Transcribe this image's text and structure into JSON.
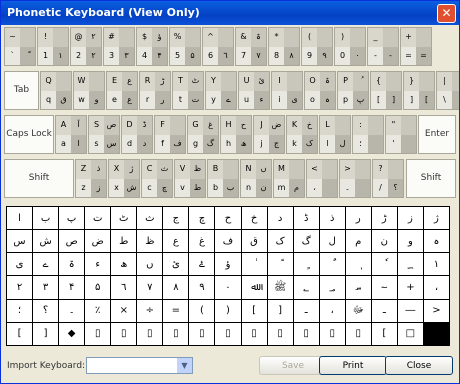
{
  "window": {
    "title": "Phonetic Keyboard (View Only)",
    "close": "✕"
  },
  "keys": {
    "row1": [
      [
        "~",
        "",
        "`",
        "ّ"
      ],
      [
        "!",
        "",
        "1",
        "١"
      ],
      [
        "@",
        "٢",
        "2",
        "٢"
      ],
      [
        "#",
        "",
        "3",
        "٣"
      ],
      [
        "$",
        "ؤ",
        "4",
        "۴"
      ],
      [
        "%",
        "",
        "5",
        "۵"
      ],
      [
        "^",
        "",
        "6",
        "٦"
      ],
      [
        "&",
        "ۃ",
        "7",
        "٧"
      ],
      [
        "*",
        "",
        "8",
        "٨"
      ],
      [
        "(",
        "",
        "9",
        "٩"
      ],
      [
        ")",
        "",
        "0",
        "٠"
      ],
      [
        "_",
        "",
        "-",
        "-"
      ],
      [
        "+",
        "",
        "=",
        "="
      ]
    ],
    "row2": [
      [
        "Q",
        "",
        "q",
        "ق"
      ],
      [
        "W",
        "",
        "w",
        "و"
      ],
      [
        "E",
        "ع",
        "e",
        "ع"
      ],
      [
        "R",
        "ڑ",
        "r",
        "ر"
      ],
      [
        "T",
        "ٹ",
        "t",
        "ت"
      ],
      [
        "Y",
        "",
        "y",
        "ے"
      ],
      [
        "U",
        "ئ",
        "u",
        "ء"
      ],
      [
        "I",
        "",
        "i",
        "ی"
      ],
      [
        "O",
        "ۃ",
        "o",
        "ہ"
      ],
      [
        "P",
        "ُ",
        "p",
        "پ"
      ],
      [
        "{",
        "",
        "[",
        "]"
      ],
      [
        "}",
        "",
        "]",
        "["
      ],
      [
        "|",
        "",
        "\\",
        ""
      ]
    ],
    "row3": [
      [
        "A",
        "آ",
        "a",
        "ا"
      ],
      [
        "S",
        "ص",
        "s",
        "س"
      ],
      [
        "D",
        "ڈ",
        "d",
        "د"
      ],
      [
        "F",
        "",
        "f",
        "ف"
      ],
      [
        "G",
        "غ",
        "g",
        "گ"
      ],
      [
        "H",
        "ح",
        "h",
        "ھ"
      ],
      [
        "J",
        "ض",
        "j",
        "ج"
      ],
      [
        "K",
        "خ",
        "k",
        "ک"
      ],
      [
        "L",
        "",
        "l",
        "ل"
      ],
      [
        ":",
        "",
        "؛",
        ""
      ],
      [
        "\"",
        "",
        "'",
        ""
      ]
    ],
    "row4": [
      [
        "Z",
        "ذ",
        "z",
        "ز"
      ],
      [
        "X",
        "ژ",
        "x",
        "ش"
      ],
      [
        "C",
        "ث",
        "c",
        "چ"
      ],
      [
        "V",
        "ظ",
        "v",
        "ط"
      ],
      [
        "B",
        "",
        "b",
        "ب"
      ],
      [
        "N",
        "ں",
        "n",
        "ن"
      ],
      [
        "M",
        "",
        "m",
        "م"
      ],
      [
        "<",
        "",
        "،",
        ""
      ],
      [
        ">",
        "",
        "۔",
        ""
      ],
      [
        "?",
        "",
        "/",
        "؟"
      ]
    ],
    "special": {
      "tab": "Tab",
      "caps": "Caps Lock",
      "enter": "Enter",
      "shift_left": "Shift",
      "shift_right": "Shift"
    }
  },
  "grid": [
    "ا",
    "ب",
    "پ",
    "ت",
    "ٹ",
    "ث",
    "ج",
    "چ",
    "ح",
    "خ",
    "د",
    "ڈ",
    "ذ",
    "ر",
    "ڑ",
    "ز",
    "ژ",
    "س",
    "ش",
    "ص",
    "ض",
    "ط",
    "ظ",
    "ع",
    "غ",
    "ف",
    "ق",
    "ک",
    "گ",
    "ل",
    "م",
    "ن",
    "و",
    "ہ",
    "ی",
    "ے",
    "ۃ",
    "ء",
    "ھ",
    "ں",
    "ئ",
    "ۓ",
    "ؤ",
    "ٰ",
    "ً",
    "ٍ",
    "ٌ",
    "ٖ",
    "ٗ",
    "؁",
    "١",
    "٢",
    "٣",
    "۴",
    "۵",
    "٦",
    "٧",
    "٨",
    "٩",
    "٠",
    "ﷲ",
    "ﷺ",
    "؂",
    "؃",
    "؄",
    "؅",
    "+",
    "،",
    "؛",
    "؟",
    "۔",
    "٪",
    "×",
    "÷",
    "=",
    "(",
    ")",
    "[",
    "]",
    "ـ",
    "،",
    "ﷻ",
    "ـ",
    "―",
    ">",
    "[",
    "]",
    "◆",
    "▯",
    "▯",
    "▯",
    "▯",
    "▯",
    "▯",
    "▯",
    "▯",
    "▯",
    "▯",
    "▯",
    "[",
    "□"
  ],
  "bottom": {
    "import_label": "Import Keyboard:",
    "save": "Save",
    "print": "Print",
    "close": "Close"
  }
}
